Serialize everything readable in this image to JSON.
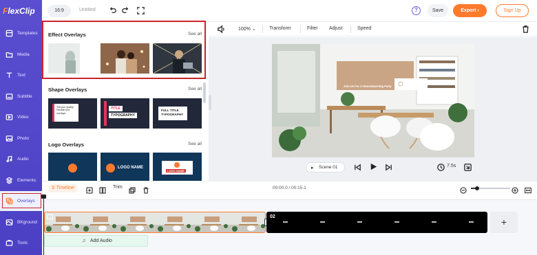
{
  "app": {
    "logo_text": "lexClip",
    "logo_letter": "F"
  },
  "topbar": {
    "ratio": "16:9",
    "title": "Untitled",
    "save_label": "Save",
    "export_label": "Export",
    "signup_label": "Sign Up",
    "help_label": "?"
  },
  "sidebar": {
    "items": [
      {
        "label": "Templates",
        "icon": "templates-icon"
      },
      {
        "label": "Media",
        "icon": "folder-icon"
      },
      {
        "label": "Text",
        "icon": "text-icon"
      },
      {
        "label": "Subtitle",
        "icon": "subtitle-icon"
      },
      {
        "label": "Video",
        "icon": "video-icon"
      },
      {
        "label": "Photo",
        "icon": "photo-icon"
      },
      {
        "label": "Audio",
        "icon": "music-icon"
      },
      {
        "label": "Elements",
        "icon": "elements-icon"
      },
      {
        "label": "Overlays",
        "icon": "overlays-icon"
      },
      {
        "label": "BKground",
        "icon": "background-icon"
      },
      {
        "label": "Tools",
        "icon": "tools-icon"
      }
    ],
    "active": "Overlays"
  },
  "panel": {
    "sections": [
      {
        "title": "Effect Overlays",
        "see_all": "See all"
      },
      {
        "title": "Shape Overlays",
        "see_all": "See all"
      },
      {
        "title": "Logo Overlays",
        "see_all": "See all"
      }
    ],
    "shape_thumbs": {
      "t1": "Tell your quality. Flexible text overlays",
      "t2a": "TITLE",
      "t2b": "TYPOGRAPHY",
      "t3a": "FULL TITLE",
      "t3b": "TYPOGRAPHY"
    },
    "logo_thumbs": {
      "t2": "LOGO NAME",
      "t3": "LOGO NAME"
    }
  },
  "preview_toolbar": {
    "zoom": "100%",
    "items": [
      "Transform",
      "Filter",
      "Adjust",
      "Speed"
    ]
  },
  "preview": {
    "overlay_text": "Join Us For A Housewarming Party",
    "scene_label": "Scene 01",
    "duration": "7.5s"
  },
  "timeline": {
    "tab_label": "Timeline",
    "trim_label": "Trim",
    "time": "00:00.0 / 00:15.1",
    "clip2_number": "02",
    "add_audio_label": "Add Audio",
    "add_clip_label": "+"
  },
  "colors": {
    "sidebar": "#4b3fc4",
    "accent": "#ff7a2d",
    "highlight": "#c9232b"
  }
}
